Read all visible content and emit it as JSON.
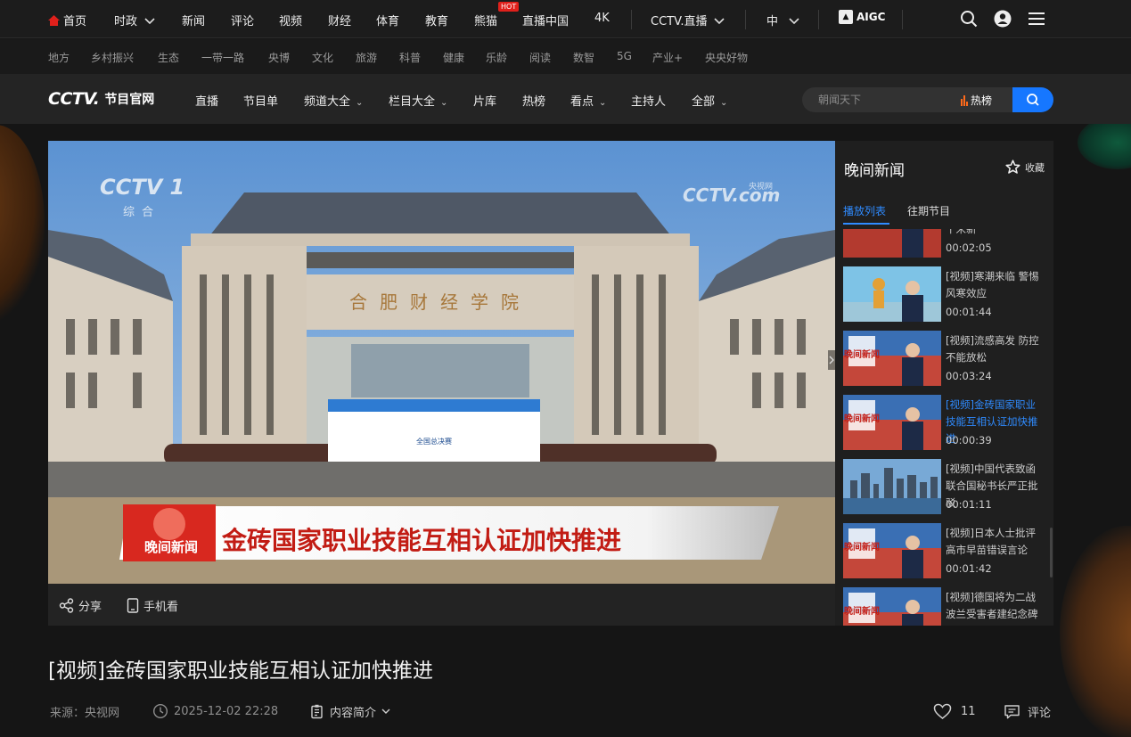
{
  "topnav": {
    "items": [
      "首页",
      "时政",
      "新闻",
      "评论",
      "视频",
      "财经",
      "体育",
      "教育",
      "熊猫",
      "直播中国",
      "4K"
    ],
    "hot_badge": "HOT",
    "live_label": "CCTV.直播",
    "lang_label": "中",
    "aigc_label": "AIGC"
  },
  "subnav": {
    "items": [
      "地方",
      "乡村振兴",
      "生态",
      "一带一路",
      "央博",
      "文化",
      "旅游",
      "科普",
      "健康",
      "乐龄",
      "阅读",
      "数智",
      "5G",
      "产业+",
      "央央好物"
    ]
  },
  "mainnav": {
    "logo_text": "CCTV.",
    "logo_sub": "节目官网",
    "items": [
      "直播",
      "节目单",
      "频道大全",
      "栏目大全",
      "片库",
      "热榜",
      "看点",
      "主持人",
      "全部"
    ],
    "dropdown_flags": [
      false,
      false,
      true,
      true,
      false,
      false,
      true,
      false,
      true
    ],
    "search_placeholder": "朝闻天下",
    "hot_label": "热榜"
  },
  "player": {
    "channel_logo": "CCTV 1",
    "channel_sub": "综合",
    "corner_logo": "CCTV.com",
    "corner_sub": "央视网",
    "gate_sign": "合肥财经学院",
    "board_title": "全国总决赛",
    "show_tag": "晚间新闻",
    "caption": "金砖国家职业技能互相认证加快推进",
    "share_label": "分享",
    "mobile_label": "手机看"
  },
  "panel": {
    "title": "晚间新闻",
    "fav_label": "收藏",
    "tabs": [
      "播放列表",
      "往期节目"
    ],
    "thumb_tag": "晚间新闻",
    "items": [
      {
        "title": "[视频]台湾同胞十年千米新",
        "duration": "00:02:05",
        "active": false
      },
      {
        "title": "[视频]寒潮来临 警惕风寒效应",
        "duration": "00:01:44",
        "active": false
      },
      {
        "title": "[视频]流感高发 防控不能放松",
        "duration": "00:03:24",
        "active": false
      },
      {
        "title": "[视频]金砖国家职业技能互相认证加快推进",
        "duration": "00:00:39",
        "active": true
      },
      {
        "title": "[视频]中国代表致函联合国秘书长严正批驳",
        "duration": "00:01:11",
        "active": false
      },
      {
        "title": "[视频]日本人士批评高市早苗错误言论",
        "duration": "00:01:42",
        "active": false
      },
      {
        "title": "[视频]德国将为二战波兰受害者建纪念碑",
        "duration": "",
        "active": false
      }
    ]
  },
  "video": {
    "title": "[视频]金砖国家职业技能互相认证加快推进",
    "source": "来源：央视网",
    "datetime": "2025-12-02 22:28",
    "intro_label": "内容简介",
    "likes": "11",
    "comment_label": "评论"
  },
  "colors": {
    "accent": "#1677ff",
    "active_text": "#2f8bff",
    "hot": "#e0201b"
  }
}
